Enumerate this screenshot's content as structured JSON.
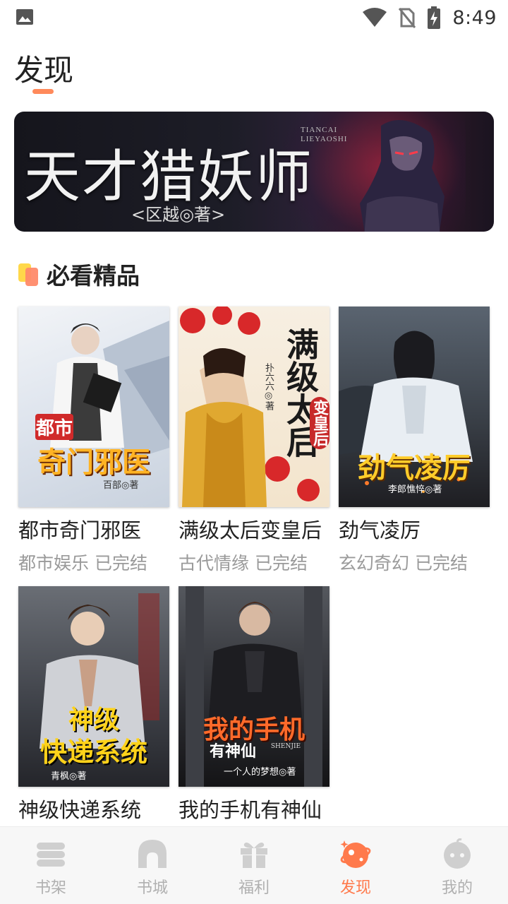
{
  "status_bar": {
    "time": "8:49",
    "icons": [
      "image-icon",
      "wifi-icon",
      "no-sim-icon",
      "battery-charging-icon"
    ]
  },
  "header": {
    "title": "发现"
  },
  "banner": {
    "title": "天才猎妖师",
    "author": "<区越◎著>",
    "pinyin_line1": "TIANCAI",
    "pinyin_line2": "LIEYAOSHI"
  },
  "section": {
    "title": "必看精品"
  },
  "books": [
    {
      "name": "都市奇门邪医",
      "meta": "都市娱乐 已完结",
      "cover_text_top": "都市",
      "cover_text_main": "奇门邪医",
      "cover_author": "百部◎著"
    },
    {
      "name": "满级太后变皇后",
      "meta": "古代情缘 已完结",
      "cover_text_main": "满级太后",
      "cover_text_sub": "变皇后",
      "cover_author": "扑六六◎著"
    },
    {
      "name": "劲气凌厉",
      "meta": "玄幻奇幻 已完结",
      "cover_text_main": "劲气凌厉",
      "cover_author": "李郎憔悴◎著"
    },
    {
      "name": "神级快递系统",
      "meta": "",
      "cover_text_top": "神级",
      "cover_text_main": "快递系统",
      "cover_author": "青枫◎著"
    },
    {
      "name": "我的手机有神仙",
      "meta": "",
      "cover_text_main": "我的手机",
      "cover_text_sub": "有神仙",
      "cover_text_pinyin": "SHENJIE",
      "cover_author": "一个人的梦想◎著"
    }
  ],
  "bottom_nav": [
    {
      "label": "书架",
      "icon": "bookshelf-icon",
      "active": false
    },
    {
      "label": "书城",
      "icon": "bookstore-icon",
      "active": false
    },
    {
      "label": "福利",
      "icon": "gift-icon",
      "active": false
    },
    {
      "label": "发现",
      "icon": "discover-icon",
      "active": true
    },
    {
      "label": "我的",
      "icon": "profile-icon",
      "active": false
    }
  ],
  "colors": {
    "accent": "#ff7a4c",
    "inactive": "#b0b0b0",
    "section_icon_yellow": "#ffd84a",
    "section_icon_orange": "#ff8a6a"
  }
}
